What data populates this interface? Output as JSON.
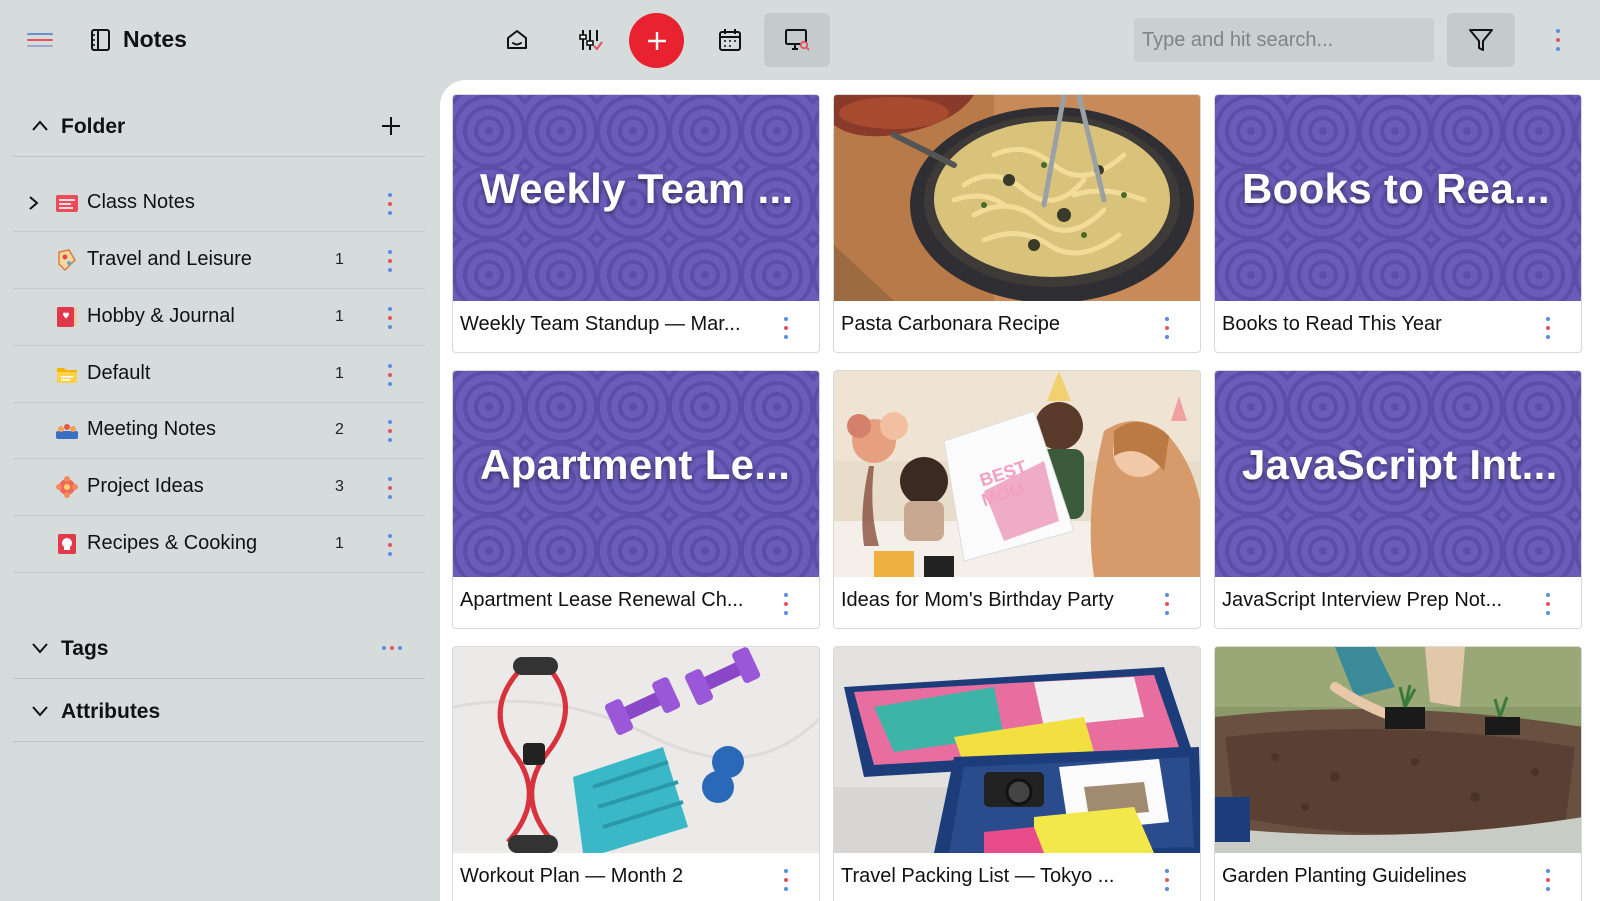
{
  "app": {
    "title": "Notes"
  },
  "toolbar": {
    "search_placeholder": "Type and hit search...",
    "add_color": "#e8232f"
  },
  "sidebar": {
    "folder_header": "Folder",
    "folders": [
      {
        "name": "Class Notes",
        "count": "",
        "icon": "class-notes-icon"
      },
      {
        "name": "Travel and Leisure",
        "count": "1",
        "icon": "travel-icon"
      },
      {
        "name": "Hobby & Journal",
        "count": "1",
        "icon": "journal-icon"
      },
      {
        "name": "Default",
        "count": "1",
        "icon": "default-folder-icon"
      },
      {
        "name": "Meeting Notes",
        "count": "2",
        "icon": "meeting-icon"
      },
      {
        "name": "Project Ideas",
        "count": "3",
        "icon": "ideas-icon"
      },
      {
        "name": "Recipes & Cooking",
        "count": "1",
        "icon": "recipe-icon"
      }
    ],
    "tags_header": "Tags",
    "attributes_header": "Attributes"
  },
  "cards": [
    {
      "thumb_title": "Weekly Team ...",
      "caption": "Weekly Team Standup — Mar...",
      "kind": "pattern"
    },
    {
      "thumb_title": "",
      "caption": "Pasta Carbonara Recipe",
      "kind": "photo-pasta"
    },
    {
      "thumb_title": "Books to Rea...",
      "caption": "Books to Read This Year",
      "kind": "pattern"
    },
    {
      "thumb_title": "Apartment Le...",
      "caption": "Apartment Lease Renewal Ch...",
      "kind": "pattern"
    },
    {
      "thumb_title": "",
      "caption": "Ideas for Mom's Birthday Party",
      "kind": "photo-birthday"
    },
    {
      "thumb_title": "JavaScript Int...",
      "caption": "JavaScript Interview Prep Not...",
      "kind": "pattern"
    },
    {
      "thumb_title": "",
      "caption": "Workout Plan — Month 2",
      "kind": "photo-workout"
    },
    {
      "thumb_title": "",
      "caption": "Travel Packing List — Tokyo ...",
      "kind": "photo-packing"
    },
    {
      "thumb_title": "",
      "caption": "Garden Planting Guidelines",
      "kind": "photo-garden"
    }
  ],
  "colors": {
    "accent": "#e8232f",
    "pattern": "#6a5cb8",
    "dots_red": "#e2535c",
    "dots_blue": "#5b8de0"
  }
}
